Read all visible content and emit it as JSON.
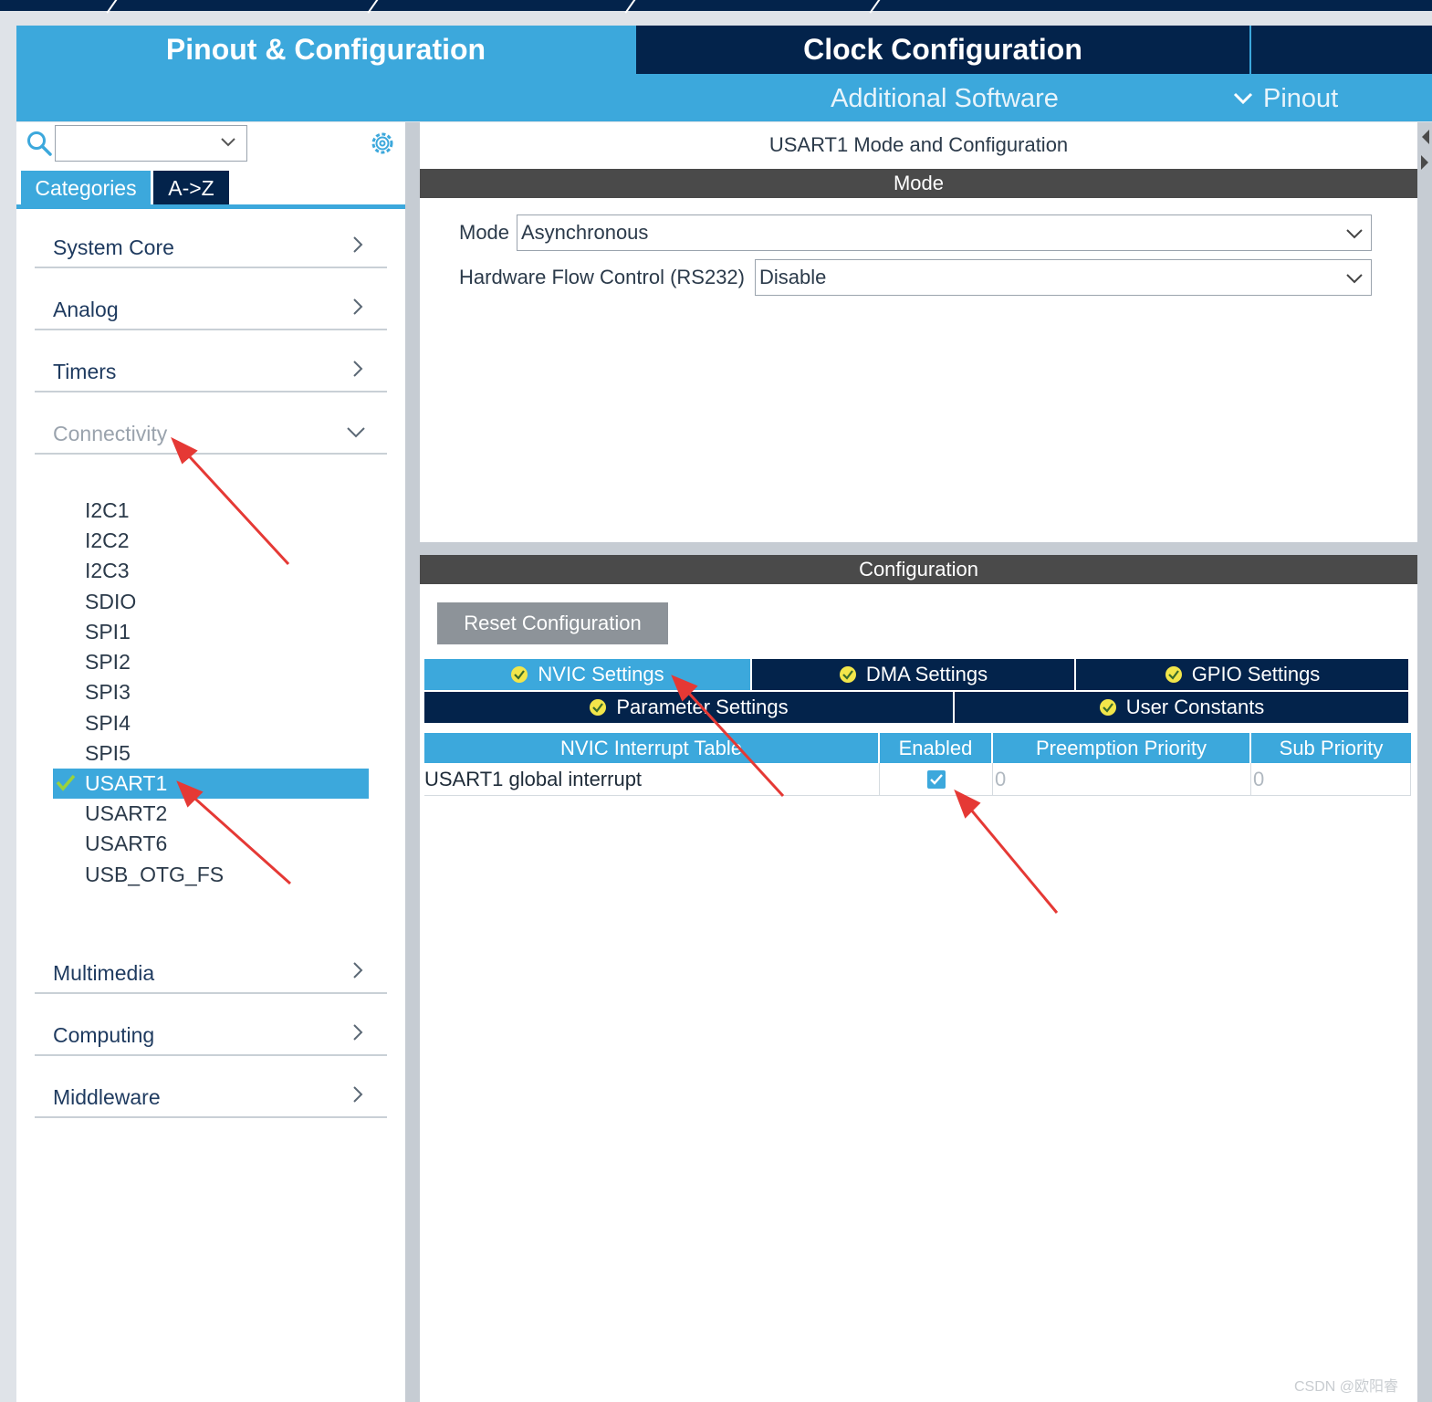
{
  "header": {
    "tabs": [
      "Pinout & Configuration",
      "Clock Configuration"
    ],
    "additional_software": "Additional Software",
    "pinout_link": "Pinout"
  },
  "sidebar": {
    "search": {
      "value": "",
      "placeholder": ""
    },
    "view_tabs": [
      "Categories",
      "A->Z"
    ],
    "categories_before": [
      "System Core",
      "Analog",
      "Timers"
    ],
    "expanded": "Connectivity",
    "connectivity_items": [
      "I2C1",
      "I2C2",
      "I2C3",
      "SDIO",
      "SPI1",
      "SPI2",
      "SPI3",
      "SPI4",
      "SPI5",
      "USART1",
      "USART2",
      "USART6",
      "USB_OTG_FS"
    ],
    "selected_item": "USART1",
    "categories_after": [
      "Multimedia",
      "Computing",
      "Middleware"
    ]
  },
  "panel": {
    "title": "USART1 Mode and Configuration",
    "mode_section": "Mode",
    "mode_label": "Mode",
    "mode_value": "Asynchronous",
    "flow_label": "Hardware Flow Control (RS232)",
    "flow_value": "Disable",
    "config_section": "Configuration",
    "reset_button": "Reset Configuration",
    "tabs_row1": [
      "NVIC Settings",
      "DMA Settings",
      "GPIO Settings"
    ],
    "tabs_row2": [
      "Parameter Settings",
      "User Constants"
    ],
    "active_tab": "NVIC Settings",
    "table": {
      "headers": [
        "NVIC Interrupt Table",
        "Enabled",
        "Preemption Priority",
        "Sub Priority"
      ],
      "rows": [
        {
          "name": "USART1 global interrupt",
          "enabled": true,
          "preemption": "0",
          "sub": "0"
        }
      ]
    }
  },
  "colors": {
    "accent": "#3ca8dc",
    "dark": "#03234b",
    "section_bar": "#4a4a4a",
    "arrow": "#e53935"
  },
  "watermark": "CSDN @欧阳睿"
}
